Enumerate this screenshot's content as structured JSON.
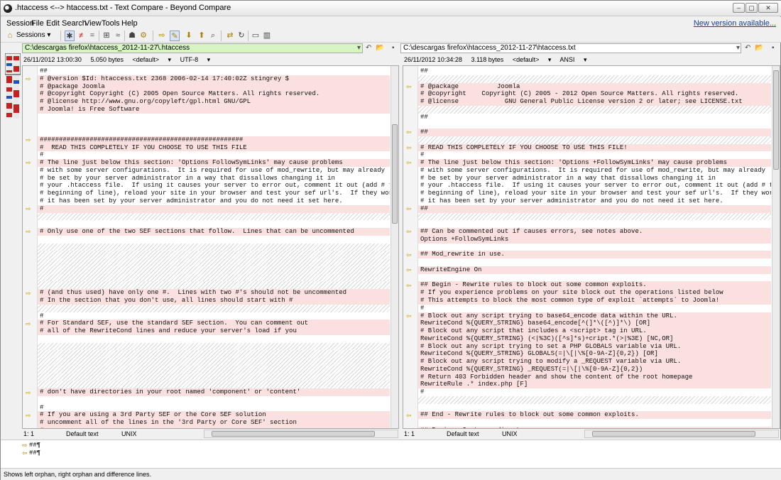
{
  "window": {
    "title": ".htaccess <--> htaccess.txt - Text Compare - Beyond Compare"
  },
  "menu": [
    "Session",
    "File",
    "Edit",
    "Search",
    "View",
    "Tools",
    "Help"
  ],
  "new_version": "New version available...",
  "toolbar": {
    "sessions_label": "Sessions"
  },
  "left": {
    "path": "C:\\descargas firefox\\htaccess_2012-11-27\\.htaccess",
    "info": {
      "date": "26/11/2012 13:00:30",
      "size": "5.050 bytes",
      "format": "<default>",
      "encoding": "UTF-8"
    },
    "status": {
      "pos": "1: 1",
      "mode": "Default text",
      "eol": "UNIX"
    },
    "lines": [
      {
        "t": "##",
        "k": "p"
      },
      {
        "t": "# @version $Id: htaccess.txt 2368 2006-02-14 17:40:02Z stingrey $",
        "k": "d"
      },
      {
        "t": "# @package Joomla",
        "k": "d"
      },
      {
        "t": "# @copyright Copyright (C) 2005 Open Source Matters. All rights reserved.",
        "k": "d"
      },
      {
        "t": "# @license http://www.gnu.org/copyleft/gpl.html GNU/GPL",
        "k": "d"
      },
      {
        "t": "# Joomla! is Free Software",
        "k": "d"
      },
      {
        "t": "",
        "k": "p"
      },
      {
        "t": "",
        "k": "p"
      },
      {
        "t": "",
        "k": "p"
      },
      {
        "t": "#####################################################",
        "k": "d"
      },
      {
        "t": "#  READ THIS COMPLETELY IF YOU CHOOSE TO USE THIS FILE",
        "k": "d"
      },
      {
        "t": "#",
        "k": "p"
      },
      {
        "t": "# The line just below this section: 'Options FollowSymLinks' may cause problems",
        "k": "d"
      },
      {
        "t": "# with some server configurations.  It is required for use of mod_rewrite, but may already",
        "k": "p"
      },
      {
        "t": "# be set by your server administrator in a way that dissallows changing it in",
        "k": "p"
      },
      {
        "t": "# your .htaccess file.  If using it causes your server to error out, comment it out (add # to",
        "k": "p"
      },
      {
        "t": "# beginning of line), reload your site in your browser and test your sef url's.  If they work,",
        "k": "p"
      },
      {
        "t": "# it has been set by your server administrator and you do not need it set here.",
        "k": "p"
      },
      {
        "t": "#",
        "k": "d"
      },
      {
        "t": "",
        "k": "e"
      },
      {
        "t": "",
        "k": "p"
      },
      {
        "t": "# Only use one of the two SEF sections that follow.  Lines that can be uncommented",
        "k": "d"
      },
      {
        "t": "",
        "k": "p"
      },
      {
        "t": "",
        "k": "e"
      },
      {
        "t": "",
        "k": "e"
      },
      {
        "t": "",
        "k": "e"
      },
      {
        "t": "",
        "k": "e"
      },
      {
        "t": "",
        "k": "e"
      },
      {
        "t": "",
        "k": "e"
      },
      {
        "t": "# (and thus used) have only one #.  Lines with two #'s should not be uncommented",
        "k": "d"
      },
      {
        "t": "# In the section that you don't use, all lines should start with #",
        "k": "d"
      },
      {
        "t": "",
        "k": "e"
      },
      {
        "t": "#",
        "k": "p"
      },
      {
        "t": "# For Standard SEF, use the standard SEF section.  You can comment out",
        "k": "d"
      },
      {
        "t": "# all of the RewriteCond lines and reduce your server's load if you",
        "k": "d"
      },
      {
        "t": "",
        "k": "p"
      },
      {
        "t": "",
        "k": "e"
      },
      {
        "t": "",
        "k": "e"
      },
      {
        "t": "",
        "k": "e"
      },
      {
        "t": "",
        "k": "e"
      },
      {
        "t": "",
        "k": "e"
      },
      {
        "t": "",
        "k": "e"
      },
      {
        "t": "# don't have directories in your root named 'component' or 'content'",
        "k": "d"
      },
      {
        "t": "",
        "k": "p"
      },
      {
        "t": "#",
        "k": "p"
      },
      {
        "t": "# If you are using a 3rd Party SEF or the Core SEF solution",
        "k": "d"
      },
      {
        "t": "# uncomment all of the lines in the '3rd Party or Core SEF' section",
        "k": "d"
      },
      {
        "t": "#",
        "k": "d"
      },
      {
        "t": "#####################################################",
        "k": "d"
      },
      {
        "t": "",
        "k": "p"
      }
    ]
  },
  "right": {
    "path": "C:\\descargas firefox\\htaccess_2012-11-27\\htaccess.txt",
    "info": {
      "date": "26/11/2012 10:34:28",
      "size": "3.118 bytes",
      "format": "<default>",
      "encoding": "ANSI"
    },
    "status": {
      "pos": "1: 1",
      "mode": "Default text",
      "eol": "UNIX"
    },
    "lines": [
      {
        "t": "##",
        "k": "p"
      },
      {
        "t": "",
        "k": "e"
      },
      {
        "t": "# @package          Joomla",
        "k": "d"
      },
      {
        "t": "# @copyright    Copyright (C) 2005 - 2012 Open Source Matters. All rights reserved.",
        "k": "d"
      },
      {
        "t": "# @license            GNU General Public License version 2 or later; see LICENSE.txt",
        "k": "d"
      },
      {
        "t": "",
        "k": "e"
      },
      {
        "t": "##",
        "k": "p"
      },
      {
        "t": "",
        "k": "p"
      },
      {
        "t": "##",
        "k": "d"
      },
      {
        "t": "",
        "k": "e"
      },
      {
        "t": "# READ THIS COMPLETELY IF YOU CHOOSE TO USE THIS FILE!",
        "k": "d"
      },
      {
        "t": "#",
        "k": "p"
      },
      {
        "t": "# The line just below this section: 'Options +FollowSymLinks' may cause problems",
        "k": "d"
      },
      {
        "t": "# with some server configurations.  It is required for use of mod_rewrite, but may already",
        "k": "p"
      },
      {
        "t": "# be set by your server administrator in a way that dissallows changing it in",
        "k": "p"
      },
      {
        "t": "# your .htaccess file.  If using it causes your server to error out, comment it out (add # to",
        "k": "p"
      },
      {
        "t": "# beginning of line), reload your site in your browser and test your sef url's.  If they work,",
        "k": "p"
      },
      {
        "t": "# it has been set by your server administrator and you do not need it set here.",
        "k": "p"
      },
      {
        "t": "##",
        "k": "d"
      },
      {
        "t": "",
        "k": "e"
      },
      {
        "t": "",
        "k": "p"
      },
      {
        "t": "## Can be commented out if causes errors, see notes above.",
        "k": "d"
      },
      {
        "t": "Options +FollowSymLinks",
        "k": "d"
      },
      {
        "t": "",
        "k": "p"
      },
      {
        "t": "## Mod_rewrite in use.",
        "k": "d"
      },
      {
        "t": "",
        "k": "p"
      },
      {
        "t": "RewriteEngine On",
        "k": "d"
      },
      {
        "t": "",
        "k": "p"
      },
      {
        "t": "## Begin - Rewrite rules to block out some common exploits.",
        "k": "d"
      },
      {
        "t": "# If you experience problems on your site block out the operations listed below",
        "k": "d"
      },
      {
        "t": "# This attempts to block the most common type of exploit `attempts` to Joomla!",
        "k": "d"
      },
      {
        "t": "#",
        "k": "p"
      },
      {
        "t": "# Block out any script trying to base64_encode data within the URL.",
        "k": "d"
      },
      {
        "t": "RewriteCond %{QUERY_STRING} base64_encode[^(]*\\([^)]*\\) [OR]",
        "k": "d"
      },
      {
        "t": "# Block out any script that includes a <script> tag in URL.",
        "k": "d"
      },
      {
        "t": "RewriteCond %{QUERY_STRING} (<|%3C)([^s]*s)+cript.*(>|%3E) [NC,OR]",
        "k": "d"
      },
      {
        "t": "# Block out any script trying to set a PHP GLOBALS variable via URL.",
        "k": "d"
      },
      {
        "t": "RewriteCond %{QUERY_STRING} GLOBALS(=|\\[|\\%[0-9A-Z]{0,2}) [OR]",
        "k": "d"
      },
      {
        "t": "# Block out any script trying to modify a _REQUEST variable via URL.",
        "k": "d"
      },
      {
        "t": "RewriteCond %{QUERY_STRING} _REQUEST(=|\\[|\\%[0-9A-Z]{0,2})",
        "k": "d"
      },
      {
        "t": "# Return 403 Forbidden header and show the content of the root homepage",
        "k": "d"
      },
      {
        "t": "RewriteRule .* index.php [F]",
        "k": "d"
      },
      {
        "t": "#",
        "k": "p"
      },
      {
        "t": "",
        "k": "e"
      },
      {
        "t": "",
        "k": "p"
      },
      {
        "t": "## End - Rewrite rules to block out some common exploits.",
        "k": "d"
      },
      {
        "t": "",
        "k": "p"
      },
      {
        "t": "## Begin - Custom redirects",
        "k": "d"
      }
    ]
  },
  "bottom": {
    "line1": "##¶",
    "line2": "##¶"
  },
  "statusbar": "Shows left orphan, right orphan and difference lines."
}
